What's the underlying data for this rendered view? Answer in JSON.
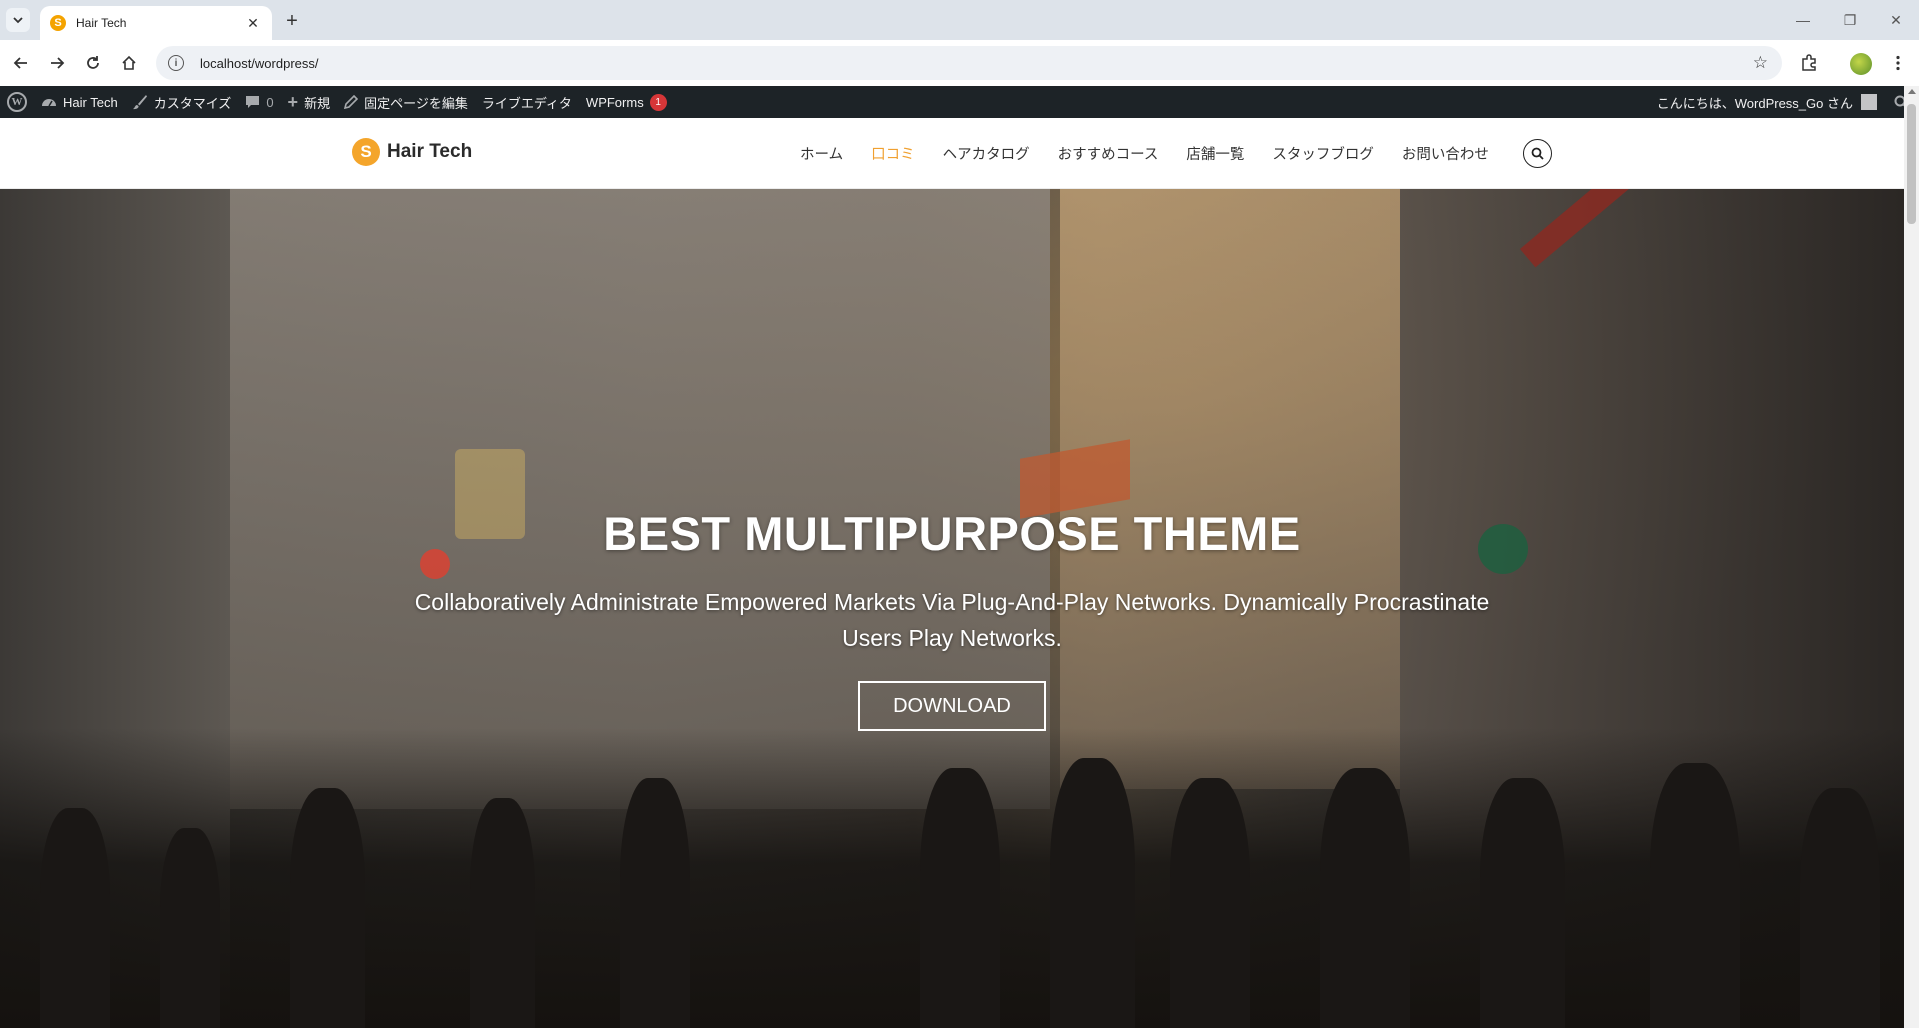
{
  "browser": {
    "tab_title": "Hair Tech",
    "tab_favicon_glyph": "S",
    "url": "localhost/wordpress/",
    "new_tab_glyph": "+",
    "close_glyph": "✕",
    "minimize_glyph": "—",
    "restore_glyph": "❐",
    "window_close_glyph": "✕"
  },
  "adminbar": {
    "wp_logo": "W",
    "site_name": "Hair Tech",
    "customize": "カスタマイズ",
    "comments_count": "0",
    "new": "新規",
    "edit_page": "固定ページを編集",
    "live_editor": "ライブエディタ",
    "wpforms": "WPForms",
    "wpforms_badge": "1",
    "greeting": "こんにちは、WordPress_Go さん"
  },
  "site": {
    "logo_glyph": "S",
    "logo_text": "Hair Tech",
    "accent_color": "#f0a030",
    "nav": [
      {
        "label": "ホーム",
        "active": false
      },
      {
        "label": "口コミ",
        "active": true
      },
      {
        "label": "ヘアカタログ",
        "active": false
      },
      {
        "label": "おすすめコース",
        "active": false
      },
      {
        "label": "店舗一覧",
        "active": false
      },
      {
        "label": "スタッフブログ",
        "active": false
      },
      {
        "label": "お問い合わせ",
        "active": false
      }
    ]
  },
  "hero": {
    "title": "BEST MULTIPURPOSE THEME",
    "subtitle": "Collaboratively Administrate Empowered Markets Via Plug-And-Play Networks. Dynamically Procrastinate Users Play Networks.",
    "button_label": "DOWNLOAD"
  }
}
